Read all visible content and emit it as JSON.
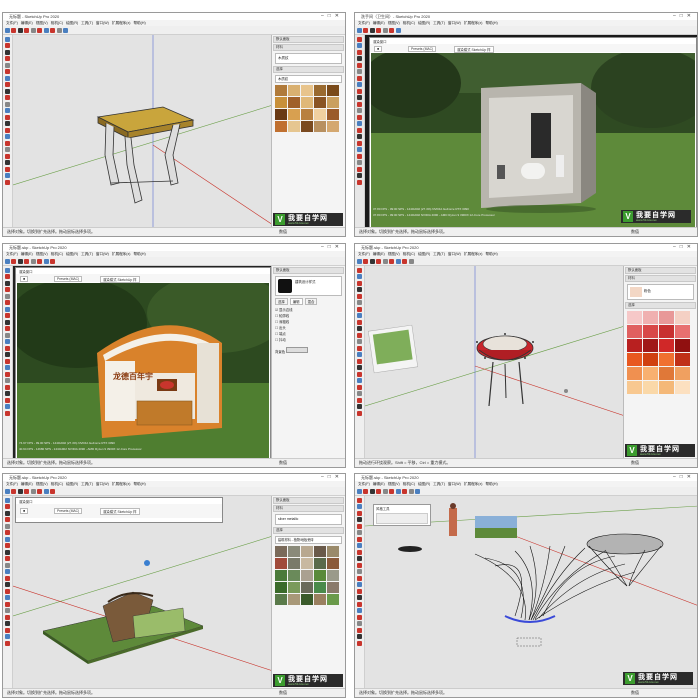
{
  "colors": {
    "chrome": "#efefef",
    "viewport": "#e3e3e3",
    "accent_red": "#c8352d",
    "grass": "#5e8a3a",
    "wood": "#c89a3a"
  },
  "panels": [
    {
      "title": "无标题 - SketchUp Pro 2020",
      "menu": [
        "文件(F)",
        "编辑(E)",
        "视图(V)",
        "相机(C)",
        "绘图(R)",
        "工具(T)",
        "窗口(W)",
        "扩展程序(x)",
        "帮助(H)"
      ],
      "status": "选择对象。切换到扩充选择。拖动鼠标选择多项。",
      "measure_label": "数值",
      "tray": {
        "title": "默认面板",
        "sections": [
          "材料",
          "编辑",
          "选择"
        ],
        "material_name": "木质纹",
        "combo_label": "木质纹"
      }
    },
    {
      "title": "洗手间（卫生间）- SketchUp Pro 2020",
      "menu": [
        "文件(F)",
        "编辑(E)",
        "视图(V)",
        "相机(C)",
        "绘图(R)",
        "工具(T)",
        "窗口(W)",
        "扩展程序(x)",
        "帮助(H)"
      ],
      "status": "选择对象。切换到扩充选择。拖动鼠标选择多项。",
      "measure_label": "数值",
      "render_window": {
        "title": "渲染窗口",
        "preset": "Presets (MAC)",
        "mode": "渲染模式 SketchUp 样"
      },
      "fps_lines": [
        "37.80 FPS - 09:00 SPS - 1440x902 (27.4%) NVIDIA GeForce RTX 3090",
        "37.80 FPS - 09:00 SPS - 1440x902 NVIDIA 4090 - AMD Ryzen 9 3900X 12-Core Processor"
      ]
    },
    {
      "title": "无标题.skp - SketchUp Pro 2020",
      "menu": [
        "文件(F)",
        "编辑(E)",
        "视图(V)",
        "相机(C)",
        "绘图(R)",
        "工具(T)",
        "窗口(W)",
        "扩展程序(x)",
        "帮助(H)"
      ],
      "status": "选择对象。切换到扩充选择。拖动鼠标选择多项。",
      "measure_label": "数值",
      "render_window": {
        "title": "渲染窗口",
        "preset": "Presets (MAC)",
        "mode": "渲染模式 SketchUp 样"
      },
      "fps_lines": [
        "74.97 FPS - 99.00 SPS - 1440x902 (27.4%) NVIDIA GeForce RTX 3090",
        "40.94 FPS - 14680 SPS - 1440x902 NVIDIA 4090 - AMD Ryzen 9 3900X 12-Core Processor"
      ],
      "booth_sign": "龙德百年宇",
      "style_panel": {
        "title": "默认面板",
        "tabs": [
          "选择",
          "编辑",
          "混合"
        ],
        "style_name": "建筑设计样式",
        "options": [
          "显示边线",
          "轮廓线",
          "深粗线",
          "出头",
          "端点",
          "抖动"
        ],
        "bg_label": "背景色"
      }
    },
    {
      "title": "无标题.skp - SketchUp Pro 2020",
      "menu": [
        "文件(F)",
        "编辑(E)",
        "视图(V)",
        "相机(C)",
        "绘图(R)",
        "工具(T)",
        "窗口(W)",
        "扩展程序(x)",
        "帮助(H)"
      ],
      "status": "拖动进行环绕观察。Shift = 平移，Ctrl = 重力模式。",
      "measure_label": "数值",
      "tray": {
        "title": "默认面板",
        "sections": [
          "材料",
          "选择",
          "编辑"
        ],
        "material_name": "粉色"
      }
    },
    {
      "title": "无标题.skp - SketchUp Pro 2020",
      "menu": [
        "文件(F)",
        "编辑(E)",
        "视图(V)",
        "相机(C)",
        "绘图(R)",
        "工具(T)",
        "窗口(W)",
        "扩展程序(x)",
        "帮助(H)"
      ],
      "status": "选择对象。切换到扩充选择。拖动鼠标选择多项。",
      "measure_label": "数值",
      "render_window": {
        "title": "渲染窗口",
        "preset": "Presets (MAC)",
        "mode": "渲染模式 SketchUp 样"
      },
      "tray": {
        "title": "默认面板",
        "sections": [
          "材料",
          "选择",
          "编辑"
        ],
        "material_name": "silver metallic",
        "combo_label": "建筑材料 - 植物/地板瓷砖"
      }
    },
    {
      "title": "无标题.skp - SketchUp Pro 2020",
      "menu": [
        "文件(F)",
        "编辑(E)",
        "视图(V)",
        "相机(C)",
        "绘图(R)",
        "工具(T)",
        "窗口(W)",
        "扩展程序(x)",
        "帮助(H)"
      ],
      "status": "选择对象。切换到扩充选择。拖动鼠标选择多项。",
      "measure_label": "数值",
      "dialog_title": "风格工具"
    }
  ],
  "logo": {
    "mark": "V",
    "brand": "我要自学网",
    "url": "www.51zxw.net"
  }
}
